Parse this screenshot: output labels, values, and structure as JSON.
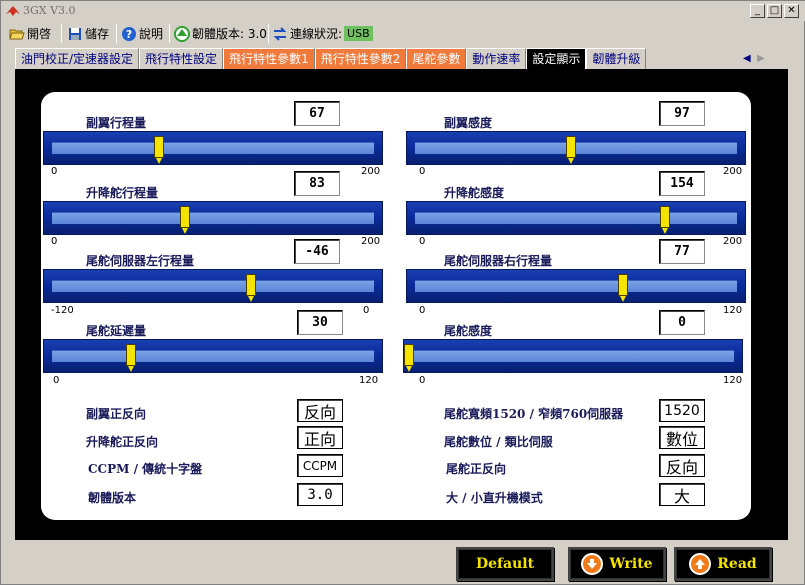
{
  "window": {
    "title": "3GX  V3.0"
  },
  "toolbar": {
    "open_label": "開啓",
    "save_label": "儲存",
    "help_label": "說明",
    "firmware_label": "韌體版本: 3.0",
    "connection_label": "連線狀況:",
    "connection_value": "USB"
  },
  "tabs": [
    {
      "label": "油門校正/定速器設定"
    },
    {
      "label": "飛行特性設定"
    },
    {
      "label": "飛行特性參數1"
    },
    {
      "label": "飛行特性參數2"
    },
    {
      "label": "尾舵參數"
    },
    {
      "label": "動作速率"
    },
    {
      "label": "設定顯示"
    },
    {
      "label": "韌體升級"
    }
  ],
  "sliders": [
    {
      "label": "副翼行程量",
      "value": "67",
      "min": "0",
      "max": "200",
      "level": 0.335
    },
    {
      "label": "副翼感度",
      "value": "97",
      "min": "0",
      "max": "200",
      "level": 0.485
    },
    {
      "label": "升降舵行程量",
      "value": "83",
      "min": "0",
      "max": "200",
      "level": 0.415
    },
    {
      "label": "升降舵感度",
      "value": "154",
      "min": "0",
      "max": "200",
      "level": 0.77
    },
    {
      "label": "尾舵伺服器左行程量",
      "value": "-46",
      "min": "-120",
      "max": "0",
      "level": 0.617
    },
    {
      "label": "尾舵伺服器右行程量",
      "value": "77",
      "min": "0",
      "max": "120",
      "level": 0.642
    },
    {
      "label": "尾舵延遲量",
      "value": "30",
      "min": "0",
      "max": "120",
      "level": 0.25
    },
    {
      "label": "尾舵感度",
      "value": "0",
      "min": "0",
      "max": "120",
      "level": 0.0
    }
  ],
  "settings": [
    {
      "label": "副翼正反向",
      "value": "反向"
    },
    {
      "label": "尾舵寬頻1520 / 窄頻760伺服器",
      "value": "1520"
    },
    {
      "label": "升降舵正反向",
      "value": "正向"
    },
    {
      "label": "尾舵數位 / 類比伺服",
      "value": "數位"
    },
    {
      "label": "CCPM / 傳統十字盤",
      "value": "CCPM"
    },
    {
      "label": "尾舵正反向",
      "value": "反向"
    },
    {
      "label": "韌體版本",
      "value": "3.0"
    },
    {
      "label": "大 / 小直升機模式",
      "value": "大"
    }
  ],
  "buttons": {
    "default_label": "Default",
    "write_label": "Write",
    "read_label": "Read"
  },
  "colors": {
    "accent_tab": "#f07a3c",
    "slider_thumb": "#f5e400",
    "usb_badge": "#6ec15e"
  }
}
